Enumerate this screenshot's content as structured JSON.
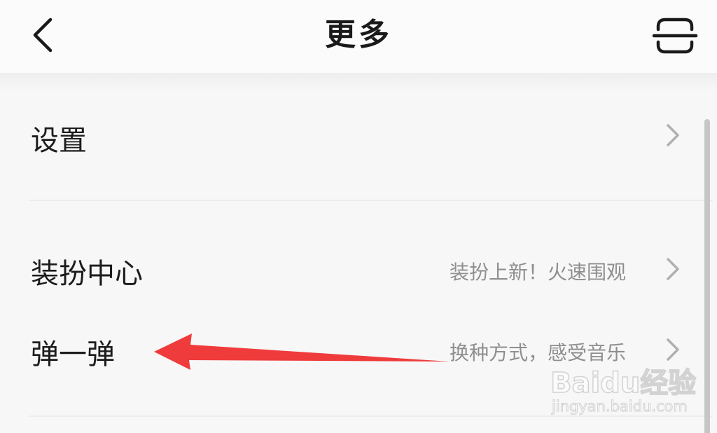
{
  "header": {
    "title": "更多",
    "back_icon": "chevron-left-icon",
    "scan_icon": "scan-icon"
  },
  "menu": {
    "items": [
      {
        "label": "设置",
        "subtitle": ""
      },
      {
        "label": "装扮中心",
        "subtitle": "装扮上新！火速围观"
      },
      {
        "label": "弹一弹",
        "subtitle": "换种方式，感受音乐"
      }
    ]
  },
  "annotation": {
    "arrow_color": "#ef3b3b"
  },
  "watermark": {
    "logo": "Baidu经验",
    "url": "jingyan.baidu.com"
  },
  "colors": {
    "background": "#f7f7f7",
    "text_primary": "#1c1c1c",
    "text_secondary": "#8f8f8f",
    "chevron": "#b0b0b0"
  }
}
